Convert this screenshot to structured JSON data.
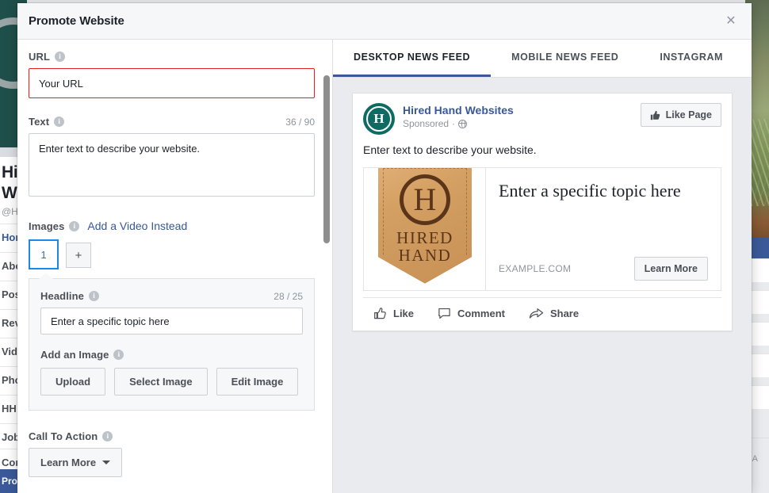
{
  "background": {
    "page_title_line1": "Hired",
    "page_title_line2": "Websites",
    "page_subtitle": "@HiredHandWebsites",
    "nav_items": [
      {
        "label": "Home",
        "active": true
      },
      {
        "label": "About",
        "active": false
      },
      {
        "label": "Posts",
        "active": false
      },
      {
        "label": "Reviews",
        "active": false
      },
      {
        "label": "Videos",
        "active": false
      },
      {
        "label": "Photos",
        "active": false
      },
      {
        "label": "HH Insights",
        "active": false
      },
      {
        "label": "Jobs",
        "active": false
      },
      {
        "label": "Community",
        "active": false
      }
    ],
    "promote_button": "Promote",
    "footer_text": "e A"
  },
  "modal": {
    "title": "Promote Website",
    "close_icon": "close-icon",
    "close_glyph": "✕"
  },
  "form": {
    "url": {
      "label": "URL",
      "info_icon": "info-icon",
      "value": "Your URL",
      "placeholder": "Your URL",
      "error_color": "#e02020"
    },
    "text": {
      "label": "Text",
      "info_icon": "info-icon",
      "counter": "36 / 90",
      "value": "Enter text to describe your website.",
      "placeholder": "Enter text to describe your website."
    },
    "images": {
      "label": "Images",
      "info_icon": "info-icon",
      "add_video_link": "Add a Video Instead",
      "thumb_label": "1",
      "add_thumb_glyph": "+"
    },
    "creative": {
      "headline": {
        "label": "Headline",
        "info_icon": "info-icon",
        "counter": "28 / 25",
        "value": "Enter a specific topic here",
        "placeholder": "Enter a specific topic here"
      },
      "add_image": {
        "label": "Add an Image",
        "info_icon": "info-icon",
        "buttons": [
          "Upload",
          "Select Image",
          "Edit Image"
        ]
      }
    },
    "cta": {
      "label": "Call To Action",
      "info_icon": "info-icon",
      "value": "Learn More"
    }
  },
  "preview": {
    "tabs": [
      {
        "label": "DESKTOP NEWS FEED",
        "active": true
      },
      {
        "label": "MOBILE NEWS FEED",
        "active": false
      },
      {
        "label": "INSTAGRAM",
        "active": false
      }
    ],
    "accent_color": "#3b5998",
    "ad": {
      "avatar_icon": "page-avatar-logo",
      "avatar_monogram": "H",
      "page_name": "Hired Hand Websites",
      "sponsored": "Sponsored",
      "sponsored_separator": "·",
      "privacy_icon": "globe-icon",
      "like_page_button": "Like Page",
      "like_page_icon": "thumbs-up-icon",
      "body_text": "Enter text to describe your website.",
      "thumbnail": {
        "icon": "hired-hand-logo",
        "monogram": "H",
        "word_line1": "HIRED",
        "word_line2": "HAND",
        "leather_color": "#d5a063",
        "ink_color": "#5a3519"
      },
      "headline": "Enter a specific topic here",
      "domain": "EXAMPLE.COM",
      "cta_button": "Learn More",
      "actions": [
        {
          "label": "Like",
          "icon": "thumbs-up-icon"
        },
        {
          "label": "Comment",
          "icon": "comment-bubble-icon"
        },
        {
          "label": "Share",
          "icon": "share-arrow-icon"
        }
      ]
    }
  }
}
